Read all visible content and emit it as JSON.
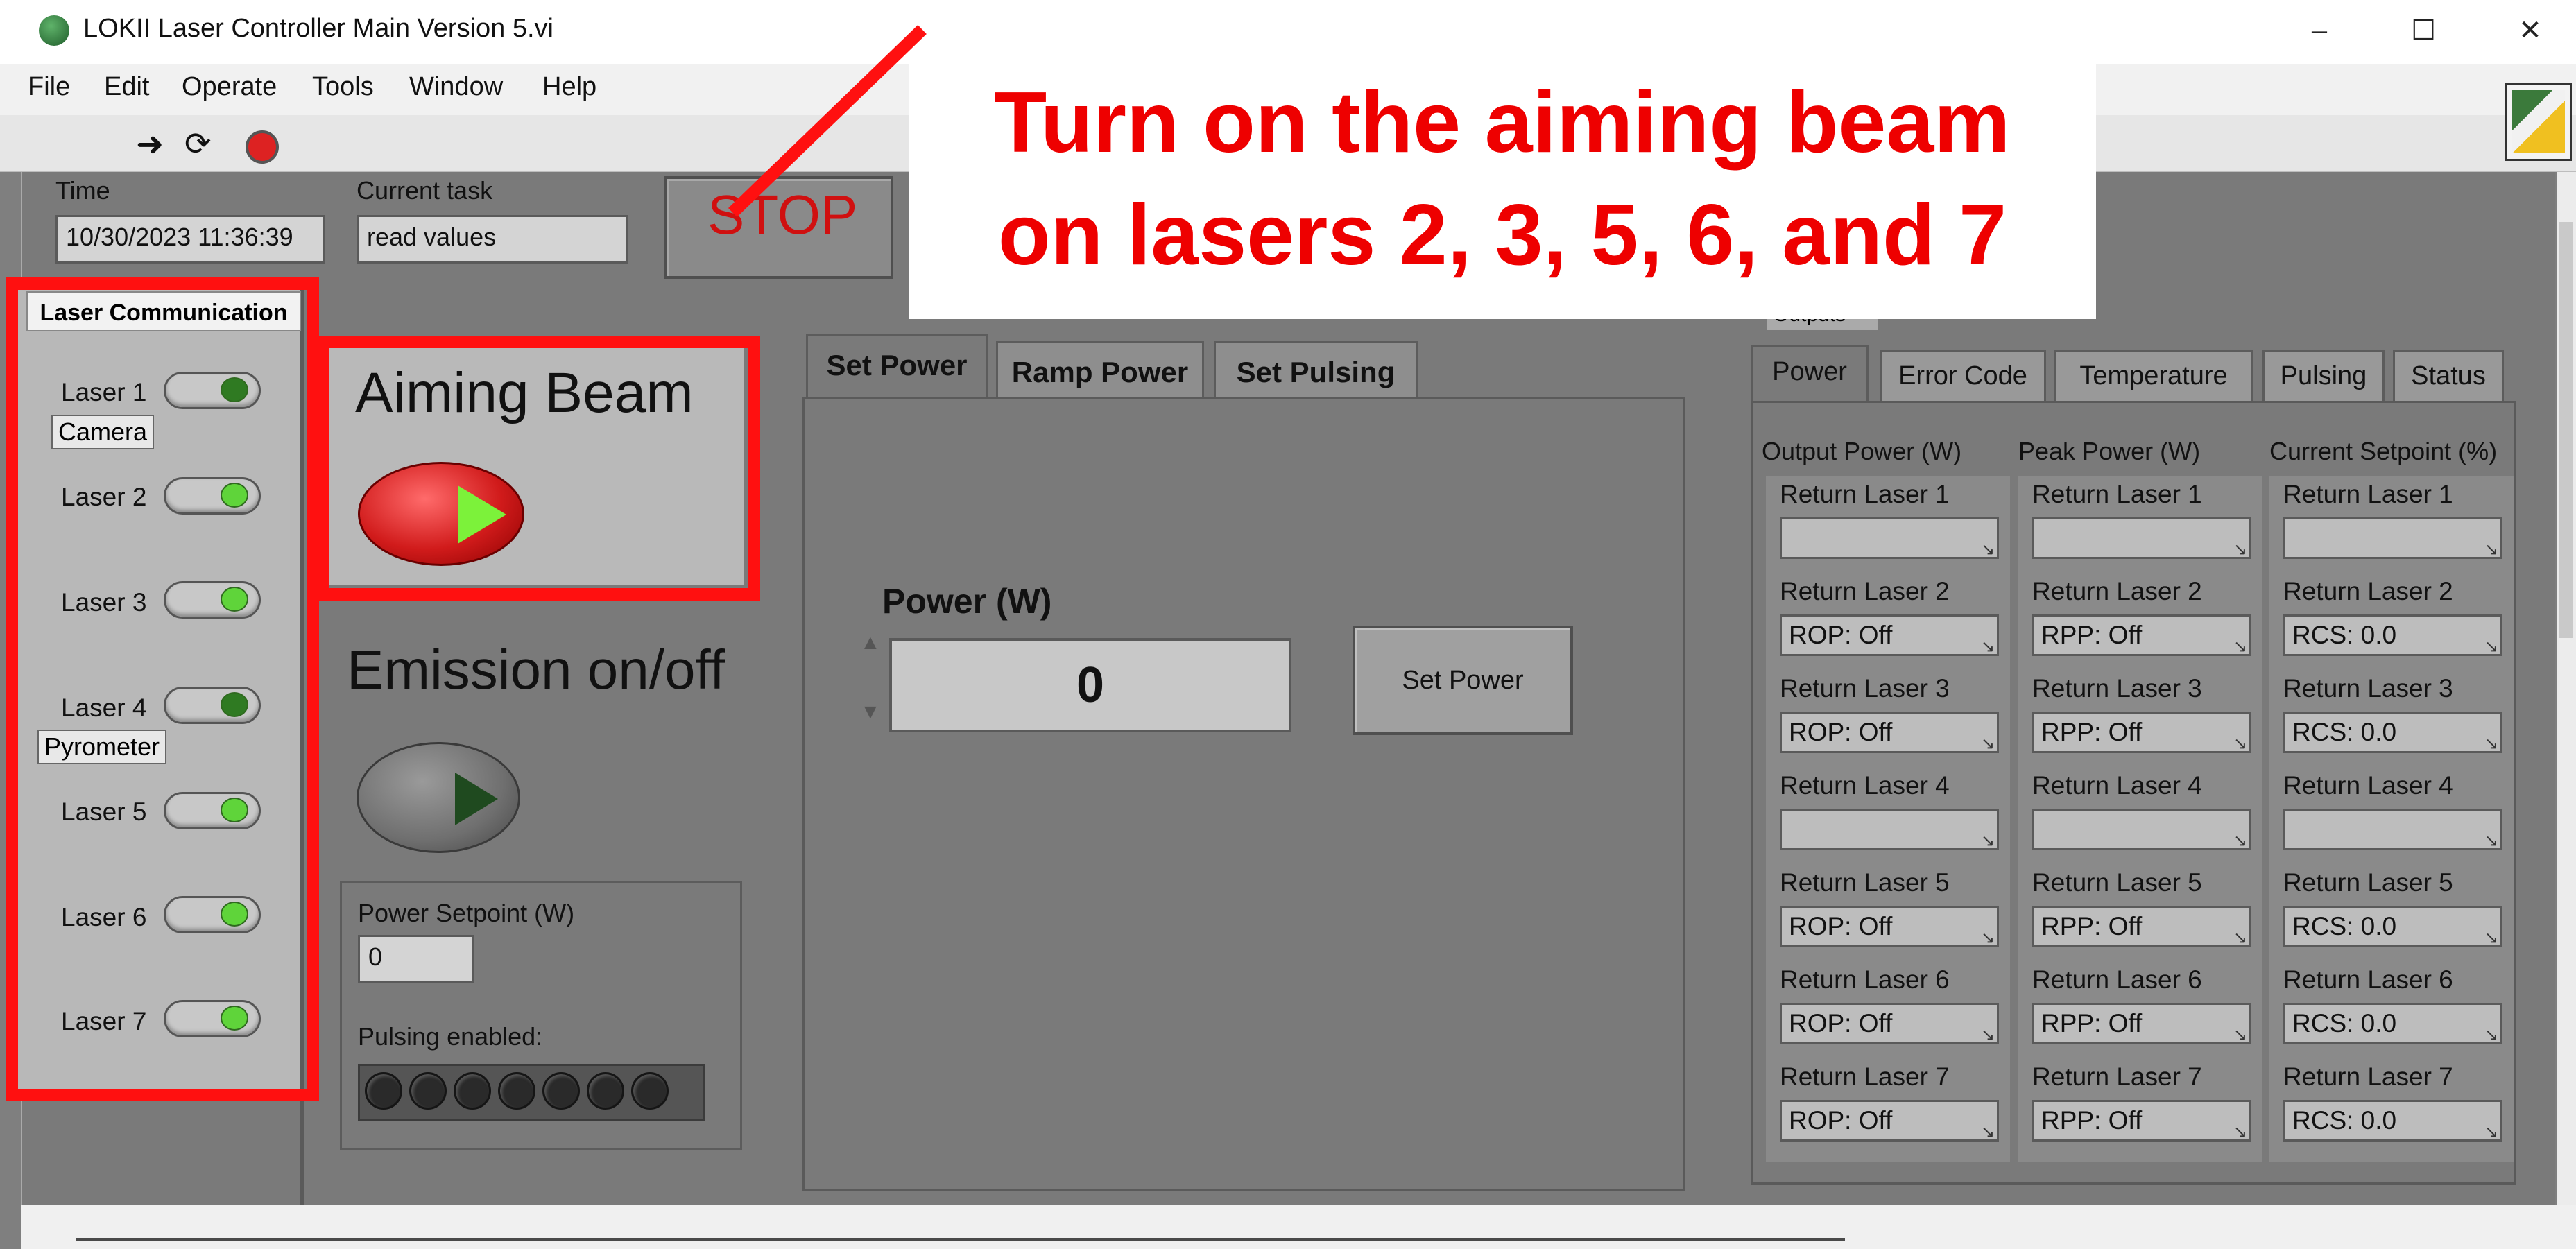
{
  "window": {
    "title": "LOKII Laser Controller Main Version 5.vi",
    "minimize": "–",
    "maximize": "☐",
    "close": "✕"
  },
  "menu": [
    "File",
    "Edit",
    "Operate",
    "Tools",
    "Window",
    "Help"
  ],
  "toolbar_icons": [
    "run-arrow-icon",
    "run-continuous-icon",
    "abort-icon"
  ],
  "header": {
    "time_label": "Time",
    "time_value": "10/30/2023 11:36:39",
    "task_label": "Current task",
    "task_value": "read values",
    "stop_label": "STOP"
  },
  "laser_comm": {
    "title": "Laser Communication",
    "lasers": [
      "Laser 1",
      "Laser 2",
      "Laser 3",
      "Laser 4",
      "Laser 5",
      "Laser 6",
      "Laser 7"
    ],
    "camera_tag": "Camera",
    "pyrometer_tag": "Pyrometer"
  },
  "aiming": {
    "title": "Aiming Beam"
  },
  "emission": {
    "title": "Emission on/off"
  },
  "setpoint": {
    "label": "Power Setpoint (W)",
    "value": "0",
    "pulsing_label": "Pulsing enabled:"
  },
  "tabs": [
    "Set Power",
    "Ramp Power",
    "Set Pulsing"
  ],
  "set_power": {
    "power_label": "Power (W)",
    "power_value": "0",
    "button": "Set Power"
  },
  "outputs": {
    "tag": "Outputs",
    "tabs": [
      "Power",
      "Error Code",
      "Temperature",
      "Pulsing",
      "Status"
    ],
    "col1_header": "Output Power (W)",
    "col2_header": "Peak Power (W)",
    "col3_header": "Current Setpoint (%)",
    "rows": [
      {
        "label": "Return Laser 1",
        "c1": "",
        "c2": "",
        "c3": ""
      },
      {
        "label": "Return Laser 2",
        "c1": "ROP: Off",
        "c2": "RPP: Off",
        "c3": "RCS: 0.0"
      },
      {
        "label": "Return Laser 3",
        "c1": "ROP: Off",
        "c2": "RPP: Off",
        "c3": "RCS: 0.0"
      },
      {
        "label": "Return Laser 4",
        "c1": "",
        "c2": "",
        "c3": ""
      },
      {
        "label": "Return Laser 5",
        "c1": "ROP: Off",
        "c2": "RPP: Off",
        "c3": "RCS: 0.0"
      },
      {
        "label": "Return Laser 6",
        "c1": "ROP: Off",
        "c2": "RPP: Off",
        "c3": "RCS: 0.0"
      },
      {
        "label": "Return Laser 7",
        "c1": "ROP: Off",
        "c2": "RPP: Off",
        "c3": "RCS: 0.0"
      }
    ]
  },
  "annotation": {
    "line1": "Turn on the aiming beam",
    "line2": "on lasers 2, 3, 5, 6, and 7",
    "color": "#ff1010"
  }
}
